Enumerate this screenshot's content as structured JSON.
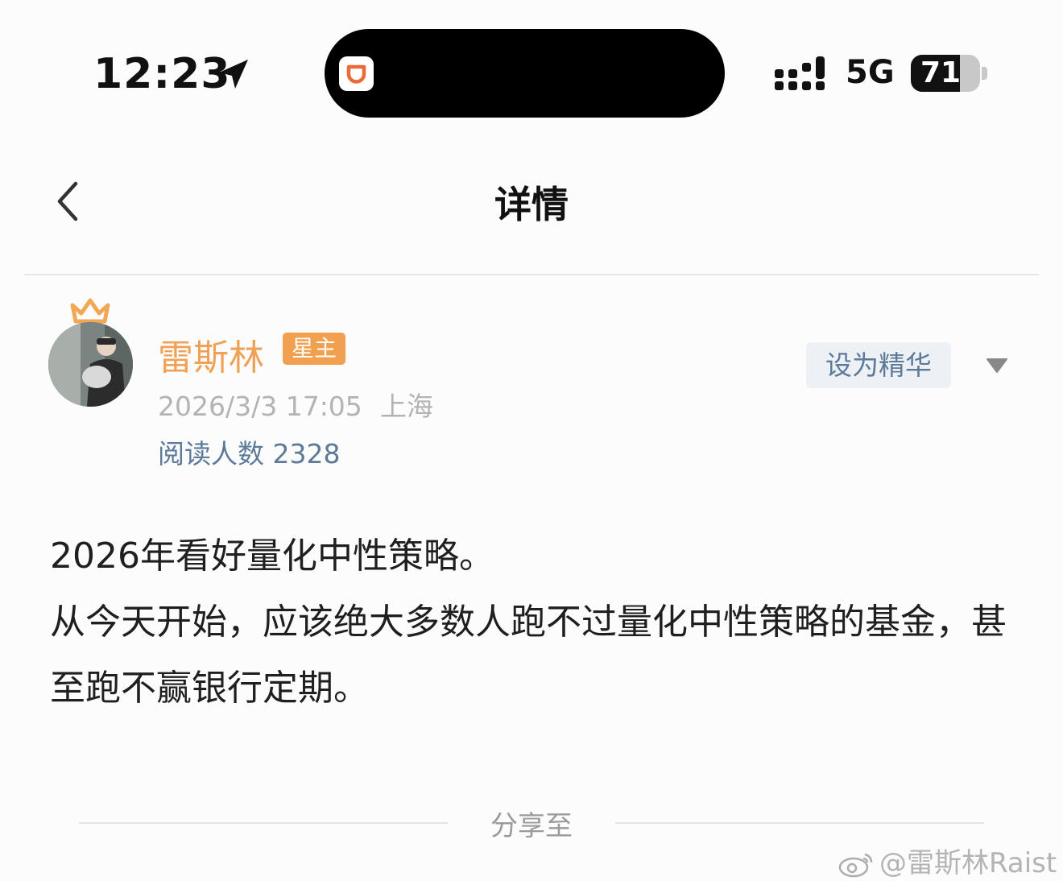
{
  "status_bar": {
    "time": "12:23",
    "network": "5G",
    "battery": "71",
    "battery_level": 0.71,
    "icons": [
      "location-arrow-icon",
      "didi-app-icon",
      "signal-icon",
      "battery-icon"
    ]
  },
  "nav": {
    "title": "详情",
    "back_icon": "chevron-left-icon"
  },
  "author": {
    "name": "雷斯林",
    "badge": "星主",
    "date": "2026/3/3 17:05",
    "location": "上海",
    "read_count": "阅读人数 2328",
    "set_featured_label": "设为精华",
    "crown_icon": "crown-icon",
    "more_icon": "triangle-down-icon"
  },
  "post": {
    "lines": [
      "2026年看好量化中性策略。",
      "从今天开始，应该绝大多数人跑不过量化中性策略的基金，甚至跑不赢银行定期。"
    ]
  },
  "share": {
    "label": "分享至"
  },
  "watermark": {
    "text": "@雷斯林Raist"
  },
  "colors": {
    "author_name": "#f0a155",
    "badge_bg": "#f1a04f",
    "link_blue": "#5d7a99",
    "button_bg": "#edf1f6",
    "text_main": "#1f1f1f",
    "text_meta": "#b3b3b3"
  }
}
